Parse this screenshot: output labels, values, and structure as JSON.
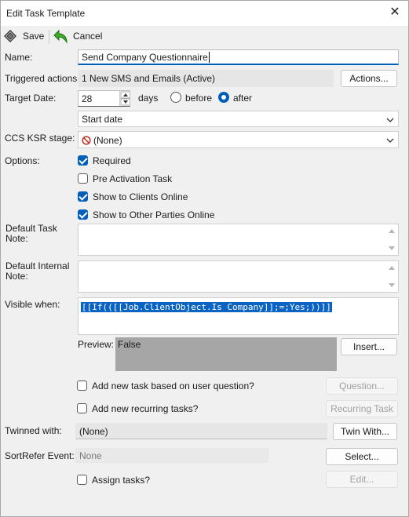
{
  "window": {
    "title": "Edit Task Template"
  },
  "toolbar": {
    "save_label": "Save",
    "cancel_label": "Cancel"
  },
  "labels": {
    "name": "Name:",
    "triggered_actions": "Triggered actions:",
    "target_date": "Target Date:",
    "days": "days",
    "before": "before",
    "after": "after",
    "ccs_ksr": "CCS KSR stage:",
    "options": "Options:",
    "default_task_note_1": "Default Task",
    "default_task_note_2": "Note:",
    "default_internal_note_1": "Default Internal",
    "default_internal_note_2": "Note:",
    "visible_when": "Visible when:",
    "preview": "Preview:",
    "twinned_with": "Twinned with:",
    "sortrefer_event": "SortRefer Event:"
  },
  "fields": {
    "name_value": "Send Company Questionnaire",
    "triggered_actions_value": "1 New SMS and Emails (Active)",
    "target_days_value": "28",
    "target_basis_value": "Start date",
    "ccs_ksr_value": "(None)",
    "visible_when_value": "[[If(([[Job.ClientObject.Is Company]];=;Yes;))]]",
    "preview_value": "False",
    "twinned_with_value": "(None)",
    "sortrefer_value": "None"
  },
  "radios": {
    "selected": "after"
  },
  "options": [
    {
      "label": "Required",
      "checked": true
    },
    {
      "label": "Pre Activation Task",
      "checked": false
    },
    {
      "label": "Show to Clients Online",
      "checked": true
    },
    {
      "label": "Show to Other Parties Online",
      "checked": true
    }
  ],
  "lower_checks": {
    "new_task_question": {
      "label": "Add new task based on user question?",
      "checked": false
    },
    "new_recurring": {
      "label": "Add new recurring tasks?",
      "checked": false
    },
    "assign_tasks": {
      "label": "Assign tasks?",
      "checked": false
    }
  },
  "buttons": {
    "actions": "Actions...",
    "insert": "Insert...",
    "question": "Question...",
    "recurring_task": "Recurring Task",
    "twin_with": "Twin With...",
    "select": "Select...",
    "edit": "Edit..."
  },
  "colors": {
    "accent": "#005fb8",
    "preview_bg": "#a6a6a6",
    "selection": "#0b64c4"
  }
}
